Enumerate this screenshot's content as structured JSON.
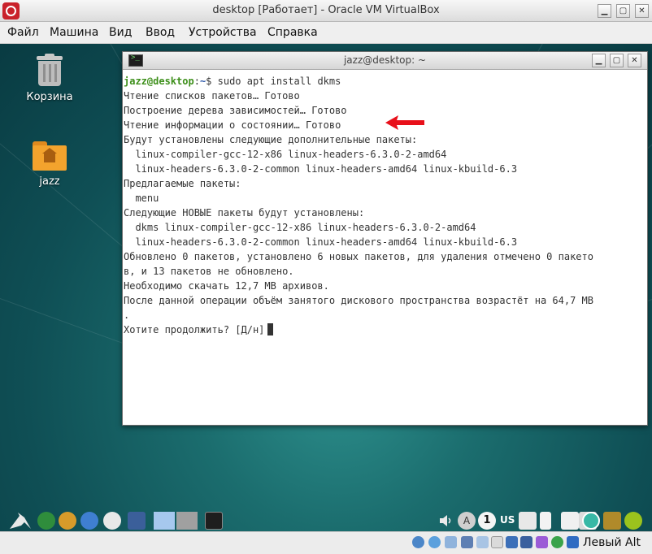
{
  "vbox": {
    "title": "desktop [Работает] - Oracle VM VirtualBox",
    "controls": {
      "minimize": "▫",
      "maximize": "▫",
      "close": "✕"
    },
    "menu": [
      "Файл",
      "Машина",
      "Вид",
      "Ввод",
      "Устройства",
      "Справка"
    ],
    "host_key": "Левый Alt"
  },
  "desktop": {
    "icons": [
      {
        "label": "Корзина",
        "icon": "trash-icon"
      },
      {
        "label": "jazz",
        "icon": "home-folder-icon"
      }
    ]
  },
  "terminal": {
    "title": "jazz@desktop: ~",
    "prompt_user": "jazz@desktop",
    "prompt_sep": ":",
    "prompt_path": "~",
    "prompt_symbol": "$ ",
    "command": "sudo apt install dkms",
    "output": [
      "Чтение списков пакетов… Готово",
      "Построение дерева зависимостей… Готово",
      "Чтение информации о состоянии… Готово",
      "Будут установлены следующие дополнительные пакеты:",
      "  linux-compiler-gcc-12-x86 linux-headers-6.3.0-2-amd64",
      "  linux-headers-6.3.0-2-common linux-headers-amd64 linux-kbuild-6.3",
      "Предлагаемые пакеты:",
      "  menu",
      "Следующие НОВЫЕ пакеты будут установлены:",
      "  dkms linux-compiler-gcc-12-x86 linux-headers-6.3.0-2-amd64",
      "  linux-headers-6.3.0-2-common linux-headers-amd64 linux-kbuild-6.3",
      "Обновлено 0 пакетов, установлено 6 новых пакетов, для удаления отмечено 0 пакето",
      "в, и 13 пакетов не обновлено.",
      "Необходимо скачать 12,7 MB архивов.",
      "После данной операции объём занятого дискового пространства возрастёт на 64,7 MB",
      "."
    ],
    "question": "Хотите продолжить? [Д/н]"
  },
  "taskbar": {
    "keyboard_layout": "US",
    "badge_a": "A",
    "badge_1": "1"
  },
  "colors": {
    "annotation_arrow": "#e8101a",
    "prompt_user": "#3d8f1a",
    "prompt_path": "#2c57a8"
  }
}
